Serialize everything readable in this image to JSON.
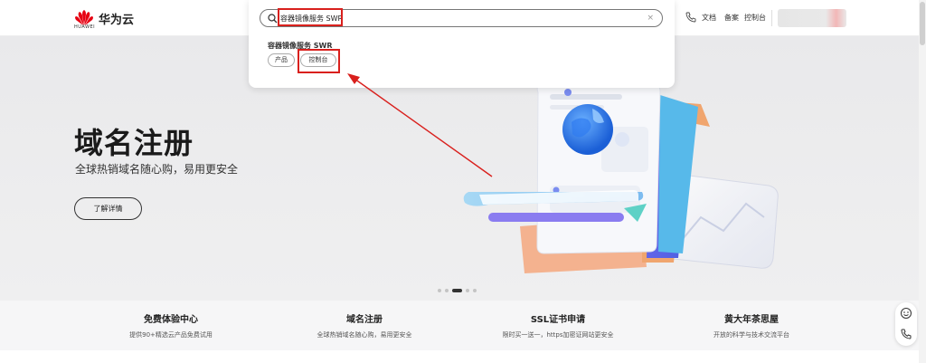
{
  "header": {
    "brand": "华为云",
    "logo_text": "HUAWEI",
    "links": [
      "文档",
      "备案",
      "控制台"
    ]
  },
  "search": {
    "query": "容器镜像服务 SWR",
    "clear_label": "×",
    "suggestion_title": "容器镜像服务 SWR",
    "chips": [
      "产品",
      "控制台"
    ]
  },
  "hero": {
    "title": "域名注册",
    "subtitle": "全球热销域名随心购，易用更安全",
    "button_label": "了解详情",
    "carousel_dots": 5,
    "active_dot": 2
  },
  "features": [
    {
      "title": "免费体验中心",
      "desc": "提供90+精选云产品免费试用"
    },
    {
      "title": "域名注册",
      "desc": "全球热销域名随心购，易用更安全"
    },
    {
      "title": "SSL证书申请",
      "desc": "限时买一送一，https加密证网站更安全"
    },
    {
      "title": "黄大年茶思屋",
      "desc": "开放的科学与技术交流平台"
    }
  ],
  "colors": {
    "highlight": "#d9201d",
    "brand_red": "#e60012"
  },
  "icons": [
    "huawei-logo-icon",
    "phone-icon",
    "search-icon",
    "close-icon",
    "smile-icon",
    "phone-call-icon"
  ]
}
